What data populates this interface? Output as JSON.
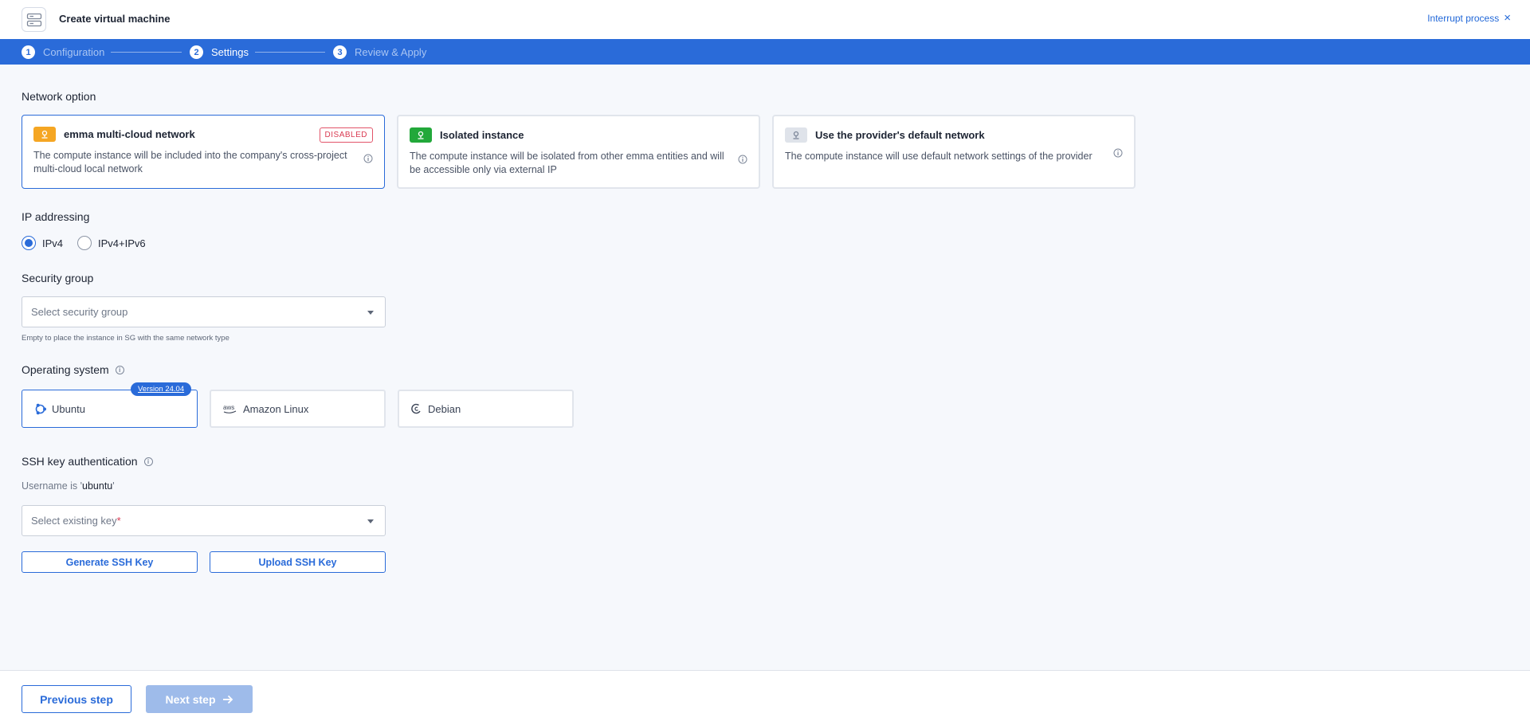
{
  "header": {
    "title": "Create virtual machine",
    "interrupt_label": "Interrupt process"
  },
  "stepper": {
    "steps": [
      {
        "number": "1",
        "label": "Configuration"
      },
      {
        "number": "2",
        "label": "Settings"
      },
      {
        "number": "3",
        "label": "Review & Apply"
      }
    ],
    "active_step": 2
  },
  "network": {
    "label": "Network option",
    "options": [
      {
        "title": "emma multi-cloud network",
        "tag": "DISABLED",
        "description": "The compute instance will be included into the company's cross-project multi-cloud local network",
        "badge_color": "#f5a623",
        "selected": true
      },
      {
        "title": "Isolated instance",
        "description": "The compute instance will be isolated from other emma entities and will be accessible only via external IP",
        "badge_color": "#22a83a",
        "selected": false
      },
      {
        "title": "Use the provider's default network",
        "description": "The compute instance will use default network settings of the provider",
        "badge_color": "#dfe3ea",
        "selected": false
      }
    ]
  },
  "ip": {
    "label": "IP addressing",
    "options": [
      {
        "label": "IPv4",
        "checked": true
      },
      {
        "label": "IPv4+IPv6",
        "checked": false
      }
    ]
  },
  "security_group": {
    "label": "Security group",
    "placeholder": "Select security group",
    "hint": "Empty to place the instance in SG with the same network type"
  },
  "os": {
    "label": "Operating system",
    "version_badge": "Version 24.04",
    "options": [
      {
        "label": "Ubuntu",
        "icon": "ubuntu-icon",
        "selected": true
      },
      {
        "label": "Amazon Linux",
        "icon": "aws-icon",
        "selected": false
      },
      {
        "label": "Debian",
        "icon": "debian-icon",
        "selected": false
      }
    ]
  },
  "ssh": {
    "label": "SSH key authentication",
    "username_prefix": "Username is '",
    "username": "ubuntu",
    "username_suffix": "'",
    "key_placeholder": "Select existing key",
    "required_mark": "*",
    "generate_label": "Generate SSH Key",
    "upload_label": "Upload SSH Key"
  },
  "footer": {
    "prev_label": "Previous step",
    "next_label": "Next step"
  },
  "colors": {
    "accent": "#2a6bd9",
    "danger": "#d93a51"
  }
}
